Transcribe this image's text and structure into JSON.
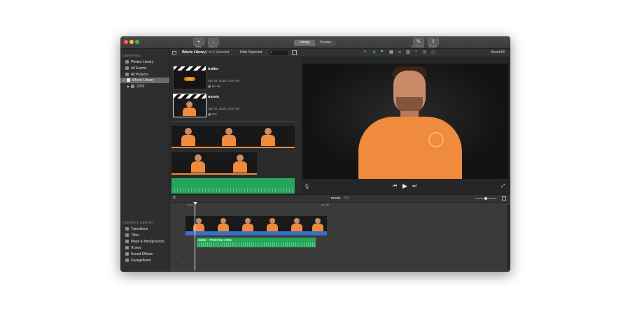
{
  "toolbar": {
    "new_label": "New",
    "import_label": "Import",
    "library_tab": "Library",
    "theater_tab": "Theater",
    "enhance_label": "Enhance",
    "share_label": "Share"
  },
  "sidebar": {
    "libraries_header": "LIBRARIES",
    "items": [
      {
        "label": "Photos Library",
        "icon": "photos-icon"
      },
      {
        "label": "All Events",
        "icon": "events-icon"
      },
      {
        "label": "All Projects",
        "icon": "projects-icon"
      },
      {
        "label": "iMovie Library",
        "icon": "star-icon",
        "selected": true
      },
      {
        "label": "2015",
        "icon": "event-icon"
      }
    ],
    "content_header": "CONTENT LIBRARY",
    "content_items": [
      {
        "label": "Transitions",
        "icon": "transitions-icon"
      },
      {
        "label": "Titles",
        "icon": "titles-icon"
      },
      {
        "label": "Maps & Backgrounds",
        "icon": "maps-icon"
      },
      {
        "label": "iTunes",
        "icon": "itunes-icon"
      },
      {
        "label": "Sound Effects",
        "icon": "sound-effects-icon"
      },
      {
        "label": "GarageBand",
        "icon": "garageband-icon"
      }
    ]
  },
  "browser": {
    "library_name": "iMovie Library",
    "selection_count": "1 of 4 Selected",
    "filter": "Hide Rejected",
    "projects": [
      {
        "title": "trailer",
        "date": "Apr 20, 2015, 5:04 AM",
        "duration": "1m 8s"
      },
      {
        "title": "movie",
        "date": "Apr 20, 2015, 5:01 AM",
        "duration": "27s"
      }
    ]
  },
  "viewer": {
    "reset_label": "Reset All"
  },
  "timeline": {
    "project_title": "movie",
    "project_duration": "27s",
    "start_time": "0.0s",
    "end_time": "27.0s",
    "audio_clip_label": "23.8s – TASCAM_2015"
  },
  "colors": {
    "accent": "#1a8bd6",
    "audio_green": "#27a55b",
    "video_track_blue": "#3a6fc7",
    "shirt_orange": "#f08a3c"
  }
}
